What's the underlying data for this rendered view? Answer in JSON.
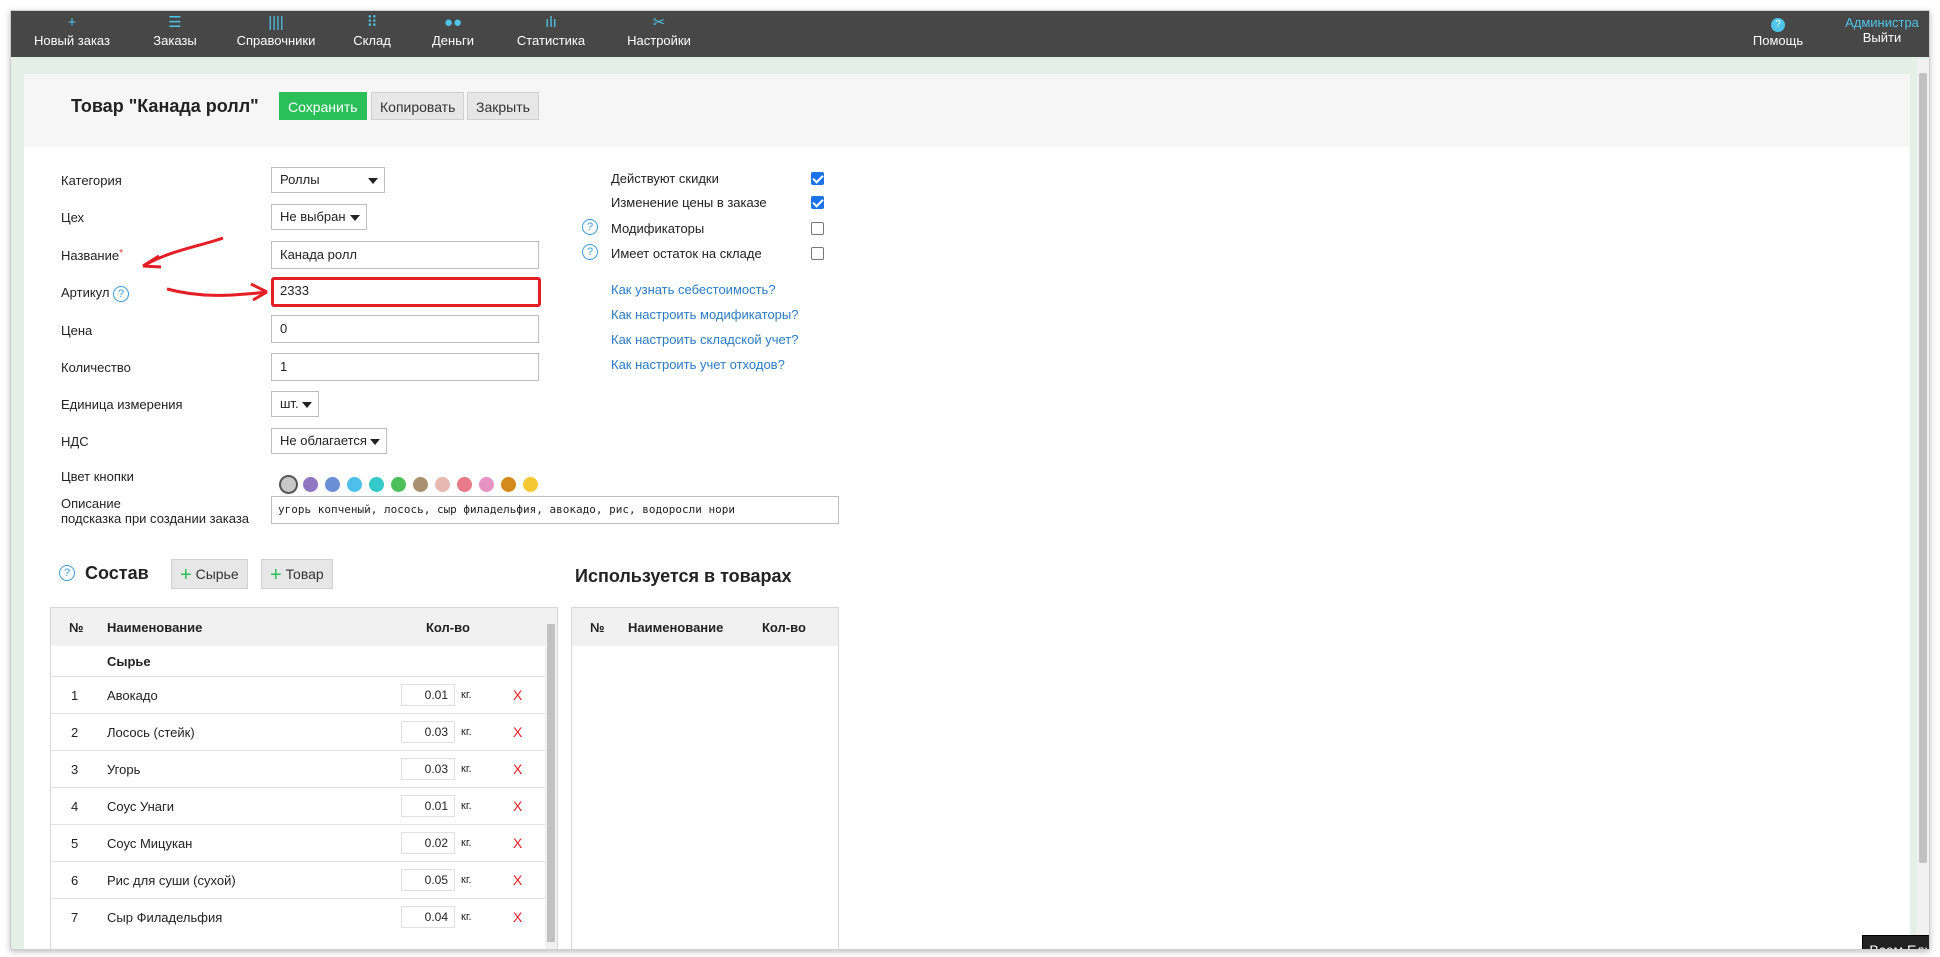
{
  "nav": {
    "items": [
      {
        "label": "Новый заказ",
        "icon": "+"
      },
      {
        "label": "Заказы",
        "icon": "☰"
      },
      {
        "label": "Справочники",
        "icon": "||||"
      },
      {
        "label": "Склад",
        "icon": "⠿"
      },
      {
        "label": "Деньги",
        "icon": "●●"
      },
      {
        "label": "Статистика",
        "icon": "ılı"
      },
      {
        "label": "Настройки",
        "icon": "✂"
      }
    ],
    "help_label": "Помощь",
    "help_icon": "?",
    "admin_label": "Администра",
    "logout_label": "Выйти"
  },
  "header": {
    "title": "Товар \"Канада ролл\"",
    "save_label": "Сохранить",
    "copy_label": "Копировать",
    "close_label": "Закрыть"
  },
  "form": {
    "category_label": "Категория",
    "category_value": "Роллы",
    "workshop_label": "Цех",
    "workshop_value": "Не выбран",
    "name_label": "Название",
    "name_required": "*",
    "name_value": "Канада ролл",
    "sku_label": "Артикул",
    "sku_value": "2333",
    "price_label": "Цена",
    "price_value": "0",
    "quantity_label": "Количество",
    "quantity_value": "1",
    "unit_label": "Единица измерения",
    "unit_value": "шт.",
    "vat_label": "НДС",
    "vat_value": "Не облагается",
    "color_label": "Цвет кнопки",
    "colors": [
      "#c8c8c8",
      "#8e76c0",
      "#6a8fd4",
      "#4dbfe8",
      "#35c9c9",
      "#4cbf5a",
      "#a89070",
      "#e6b8b0",
      "#e87a8a",
      "#e693c2",
      "#d48a1a",
      "#f4c832"
    ],
    "description_label": "Описание",
    "description_hint": "подсказка при создании заказа",
    "description_value": "угорь копченый, лосось, сыр филадельфия, авокадо, рис, водоросли нори"
  },
  "options": {
    "discounts_label": "Действуют скидки",
    "discounts_checked": true,
    "price_change_label": "Изменение цены в заказе",
    "price_change_checked": true,
    "modifiers_label": "Модификаторы",
    "modifiers_checked": false,
    "stock_label": "Имеет остаток на складе",
    "stock_checked": false,
    "links": [
      "Как узнать себестоимость?",
      "Как настроить модификаторы?",
      "Как настроить складской учет?",
      "Как настроить учет отходов?"
    ]
  },
  "composition": {
    "title": "Состав",
    "add_raw_label": "Сырье",
    "add_product_label": "Товар",
    "col_num": "№",
    "col_name": "Наименование",
    "col_qty": "Кол-во",
    "group_label": "Сырье",
    "rows": [
      {
        "num": "1",
        "name": "Авокадо",
        "qty": "0.01",
        "unit": "кг."
      },
      {
        "num": "2",
        "name": "Лосось (стейк)",
        "qty": "0.03",
        "unit": "кг."
      },
      {
        "num": "3",
        "name": "Угорь",
        "qty": "0.03",
        "unit": "кг."
      },
      {
        "num": "4",
        "name": "Соус Унаги",
        "qty": "0.01",
        "unit": "кг."
      },
      {
        "num": "5",
        "name": "Соус Мицукан",
        "qty": "0.02",
        "unit": "кг."
      },
      {
        "num": "6",
        "name": "Рис для суши (сухой)",
        "qty": "0.05",
        "unit": "кг."
      },
      {
        "num": "7",
        "name": "Сыр Филадельфия",
        "qty": "0.04",
        "unit": "кг."
      }
    ],
    "delete_label": "X"
  },
  "used_in": {
    "title": "Используется в товарах",
    "col_num": "№",
    "col_name": "Наименование",
    "col_qty": "Кол-во"
  },
  "badge": "Всем Еды"
}
